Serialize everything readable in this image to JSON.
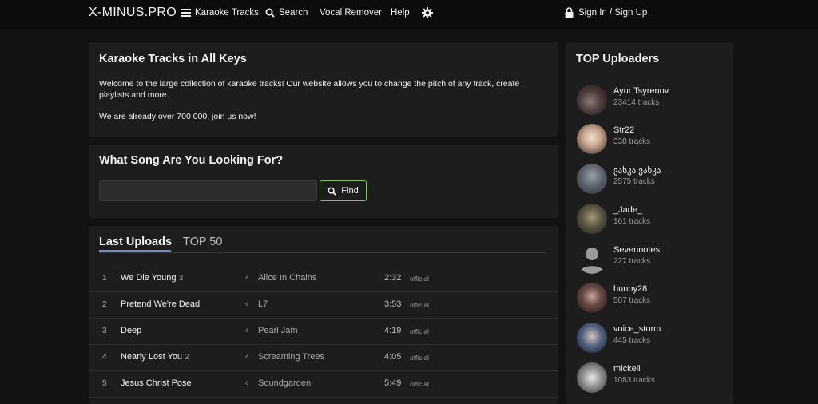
{
  "nav": {
    "logo": "X-MINUS.PRO",
    "karaoke": "Karaoke Tracks",
    "search": "Search",
    "vocal": "Vocal Remover",
    "help": "Help",
    "signin": "Sign In / Sign Up"
  },
  "intro": {
    "title": "Karaoke Tracks in All Keys",
    "line1": "Welcome to the large collection of karaoke tracks! Our website allows you to change the pitch of any track, create",
    "line2": "playlists and more.",
    "line3": "We are already over 700 000, join us now!"
  },
  "search": {
    "title": "What Song Are You Looking For?",
    "value": "",
    "button": "Find"
  },
  "tabs": {
    "active": "Last Uploads",
    "inactive": "TOP 50"
  },
  "tracks": [
    {
      "num": "1",
      "title": "We Die Young",
      "keys": "3",
      "artist": "Alice In Chains",
      "duration": "2:32",
      "tag": "official"
    },
    {
      "num": "2",
      "title": "Pretend We're Dead",
      "keys": "",
      "artist": "L7",
      "duration": "3:53",
      "tag": "official"
    },
    {
      "num": "3",
      "title": "Deep",
      "keys": "",
      "artist": "Pearl Jam",
      "duration": "4:19",
      "tag": "official"
    },
    {
      "num": "4",
      "title": "Nearly Lost You",
      "keys": "2",
      "artist": "Screaming Trees",
      "duration": "4:05",
      "tag": "official"
    },
    {
      "num": "5",
      "title": "Jesus Christ Pose",
      "keys": "",
      "artist": "Soundgarden",
      "duration": "5:49",
      "tag": "official"
    }
  ],
  "uploaders": {
    "title": "TOP Uploaders",
    "items": [
      {
        "name": "Ayur Tsyrenov",
        "count": "23414 tracks",
        "color": "#5a4a48"
      },
      {
        "name": "Str22",
        "count": "338 tracks",
        "color": "#d9c7b8"
      },
      {
        "name": "ვახკა ვახკა",
        "count": "2575 tracks",
        "color": "#6b7280"
      },
      {
        "name": "_Jade_",
        "count": "161 tracks",
        "color": "#4a4a3c"
      },
      {
        "name": "Sevennotes",
        "count": "227 tracks",
        "color": "#9a9a9a"
      },
      {
        "name": "hunny28",
        "count": "507 tracks",
        "color": "#3b2a2a"
      },
      {
        "name": "voice_storm",
        "count": "445 tracks",
        "color": "#23324f"
      },
      {
        "name": "mickell",
        "count": "1083 tracks",
        "color": "#8a8a8a"
      }
    ]
  }
}
